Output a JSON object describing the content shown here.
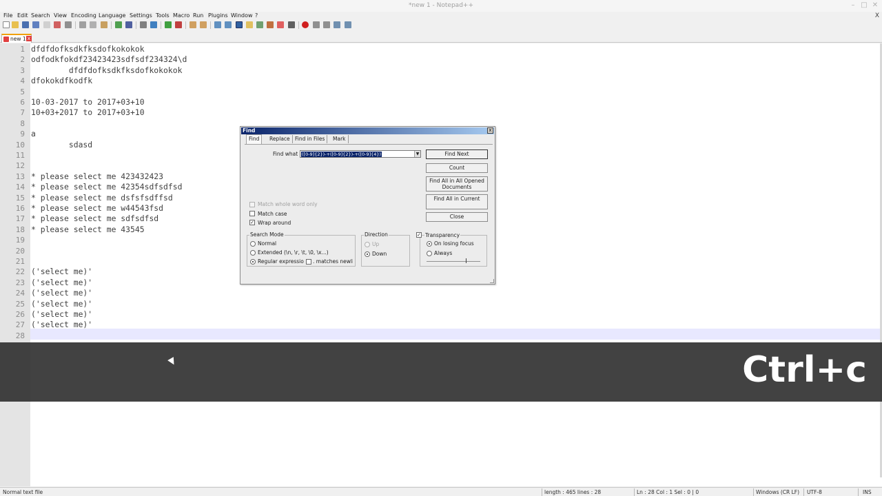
{
  "window": {
    "title": "*new 1 - Notepad++",
    "minimize": "–",
    "maximize": "□",
    "close": "✕"
  },
  "menu": {
    "items": [
      "File",
      "Edit",
      "Search",
      "View",
      "Encoding",
      "Language",
      "Settings",
      "Tools",
      "Macro",
      "Run",
      "Plugins",
      "Window",
      "?"
    ],
    "close_doc": "X"
  },
  "tabs": [
    {
      "label": "new 1",
      "close": "x"
    }
  ],
  "editor": {
    "lines": [
      "dfdfdofksdkfksdofkokokok",
      "odfodkfokdf23423423sdfsdf234324\\d",
      "        dfdfdofksdkfksdofkokokok",
      "dfokokdfkodfk",
      "",
      "10-03-2017 to 2017+03+10",
      "10+03+2017 to 2017+03+10",
      "",
      "a",
      "        sdasd",
      "",
      "",
      "* please select me 423432423",
      "* please select me 42354sdfsdfsd",
      "* please select me dsfsfsdffsd",
      "* please select me w44543fsd",
      "* please select me sdfsdfsd",
      "* please select me 43545",
      "",
      "",
      "",
      "('select me)'",
      "('select me)'",
      "('select me)'",
      "('select me)'",
      "('select me)'",
      "('select me)'",
      ""
    ],
    "line_numbers": [
      "1",
      "2",
      "3",
      "4",
      "5",
      "6",
      "7",
      "8",
      "9",
      "10",
      "11",
      "12",
      "13",
      "14",
      "15",
      "16",
      "17",
      "18",
      "19",
      "20",
      "21",
      "22",
      "23",
      "24",
      "25",
      "26",
      "27",
      "28"
    ]
  },
  "overlay": {
    "keystroke": "Ctrl+c"
  },
  "find_dialog": {
    "title": "Find",
    "close": "x",
    "tabs": [
      "Find",
      "Replace",
      "Find in Files",
      "Mark"
    ],
    "active_tab": "Find",
    "find_what_label": "Find what :",
    "find_what_value": "([0-9]{2})-+([0-9]{2})-+([0-9]{4})",
    "buttons": {
      "find_next": "Find Next",
      "count": "Count",
      "find_all_opened": "Find All in All Opened Documents",
      "find_all_current": "Find All in Current",
      "close": "Close"
    },
    "options": {
      "match_whole_word": "Match whole word only",
      "match_case": "Match case",
      "wrap_around": "Wrap around",
      "wrap_around_checked": true,
      "match_case_checked": false,
      "match_whole_word_checked": false
    },
    "search_mode": {
      "title": "Search Mode",
      "normal": "Normal",
      "extended": "Extended (\\n, \\r, \\t, \\0, \\x...)",
      "regex": "Regular expression",
      "matches_newline": ". matches newline",
      "selected": "regex"
    },
    "direction": {
      "title": "Direction",
      "up": "Up",
      "down": "Down",
      "selected": "down"
    },
    "transparency": {
      "title": "Transparency",
      "checked": true,
      "on_losing_focus": "On losing focus",
      "always": "Always",
      "selected": "on_losing_focus",
      "level": 0.73
    }
  },
  "statusbar": {
    "file_type": "Normal text file",
    "length_lines": "length : 465    lines : 28",
    "position": "Ln : 28    Col : 1    Sel : 0 | 0",
    "eol": "Windows (CR LF)",
    "encoding": "UTF-8",
    "mode": "INS"
  },
  "colors": {
    "current_line": "#e8e8ff",
    "selection": "#0a246a",
    "overlay": "#323232"
  }
}
